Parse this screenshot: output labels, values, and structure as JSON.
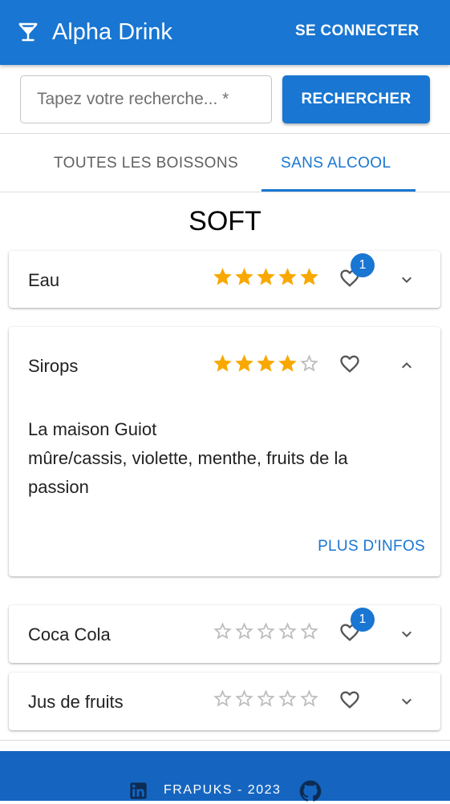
{
  "app": {
    "brand": "Alpha Drink",
    "login_label": "SE CONNECTER",
    "logo_icon": "cocktail-icon"
  },
  "search": {
    "placeholder": "Tapez votre recherche... *",
    "value": "",
    "button_label": "RECHERCHER"
  },
  "tabs": [
    {
      "label": "TOUTES LES BOISSONS",
      "active": false
    },
    {
      "label": "SANS ALCOOL",
      "active": true
    }
  ],
  "section": {
    "title": "SOFT"
  },
  "drinks": [
    {
      "name": "Eau",
      "rating": 5,
      "likes": "1",
      "expanded": false
    },
    {
      "name": "Sirops",
      "rating": 4,
      "likes": "",
      "expanded": true,
      "description": "La maison Guiot\nmûre/cassis, violette, menthe, fruits de la passion",
      "more_label": "PLUS D'INFOS"
    },
    {
      "name": "Coca Cola",
      "rating": 0,
      "likes": "1",
      "expanded": false
    },
    {
      "name": "Jus de fruits",
      "rating": 0,
      "likes": "",
      "expanded": false
    }
  ],
  "footer": {
    "credit": "FRAPUKS - 2023",
    "icons": [
      "linkedin-icon",
      "github-icon"
    ]
  },
  "colors": {
    "primary": "#1976d2",
    "footer": "#1565c0",
    "star": "#f9a800",
    "star_empty": "#bdbdbd"
  }
}
